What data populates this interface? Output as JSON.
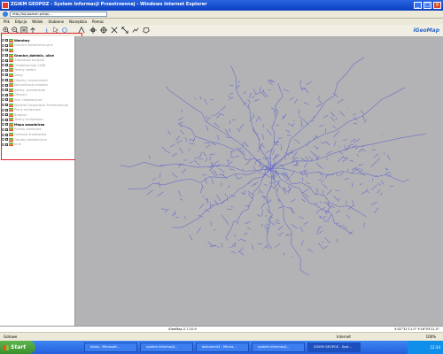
{
  "window": {
    "title": "ZGiKM GEOPOZ - System Informacji Przestrzennej - Windows Internet Explorer",
    "url": "http://sip.poznan.pl/sip/..."
  },
  "menubar": [
    "Plik",
    "Edycja",
    "Widok",
    "Ulubione",
    "Narzędzia",
    "Pomoc"
  ],
  "toolbar": {
    "brand": "iGeoMap"
  },
  "layers": [
    {
      "label": "Warstwy",
      "bold": true,
      "dim": false
    },
    {
      "label": "Granice administracyjne",
      "bold": false,
      "dim": true
    },
    {
      "label": "...",
      "bold": false,
      "dim": true
    },
    {
      "label": "Granice_dzielnic, ulice",
      "bold": true,
      "dim": false
    },
    {
      "label": "Zabudowa budynki",
      "bold": false,
      "dim": true
    },
    {
      "label": "Ortofotomapa 2008",
      "bold": false,
      "dim": true
    },
    {
      "label": "Tereny zieleni",
      "bold": false,
      "dim": true
    },
    {
      "label": "Drogi",
      "bold": false,
      "dim": true
    },
    {
      "label": "Obiekty użyteczności",
      "bold": false,
      "dim": true
    },
    {
      "label": "Komunikacja miejska",
      "bold": false,
      "dim": true
    },
    {
      "label": "Szkoły, przedszkola",
      "bold": false,
      "dim": true
    },
    {
      "label": "Obszary",
      "bold": false,
      "dim": true
    },
    {
      "label": "Sieć ciepłownicza",
      "bold": false,
      "dim": true
    },
    {
      "label": "Wydział Gospodarki Przestrzennej",
      "bold": false,
      "dim": true
    },
    {
      "label": "Plany miejscowe",
      "bold": false,
      "dim": true
    },
    {
      "label": "Budynki",
      "bold": false,
      "dim": true
    },
    {
      "label": "Tereny budowlane",
      "bold": false,
      "dim": true
    },
    {
      "label": "Mapa zasadnicza",
      "bold": true,
      "dim": false
    },
    {
      "label": "Punkty adresowe",
      "bold": false,
      "dim": true
    },
    {
      "label": "Ochrona środowiska",
      "bold": false,
      "dim": true
    },
    {
      "label": "Obręby ewidencyjne",
      "bold": false,
      "dim": true
    },
    {
      "label": "Inne",
      "bold": false,
      "dim": true
    }
  ],
  "map_status": {
    "version": "iGeoMap 2.7.10.9",
    "coords": "X:52°31'11.0\" Y:16°53'11.0\""
  },
  "ie_status": {
    "left": "Gotowe",
    "zone": "Internet",
    "zoom": "100%"
  },
  "taskbar": {
    "start": "Start",
    "tasks": [
      "Inbox - Microsoft...",
      "system informacji...",
      "dokument3 - Micros...",
      "system informacji...",
      "ZGiKM GEOPOZ - Syst..."
    ],
    "time": "12:34"
  },
  "colors": {
    "map_bg": "#b3b3b5",
    "roads": "#6a6fc8",
    "highlight": "#e0202c"
  }
}
